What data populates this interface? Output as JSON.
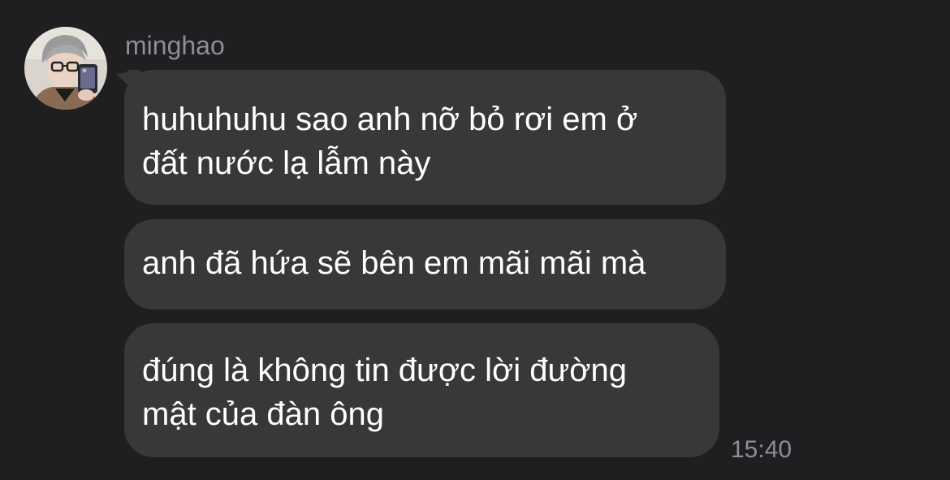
{
  "sender": {
    "name": "minghao",
    "avatar": "avatar-photo"
  },
  "messages": [
    {
      "text": "huhuhuhu sao anh nỡ bỏ rơi em ở\nđất nước lạ lẫm này"
    },
    {
      "text": "anh đã hứa sẽ bên em mãi mãi mà"
    },
    {
      "text": "đúng là không tin được lời đường\nmật của đàn ông"
    }
  ],
  "timestamp": "15:40",
  "colors": {
    "background": "#1f1f21",
    "bubble": "#38383a",
    "text": "#ffffff",
    "meta": "#8e8e93"
  }
}
